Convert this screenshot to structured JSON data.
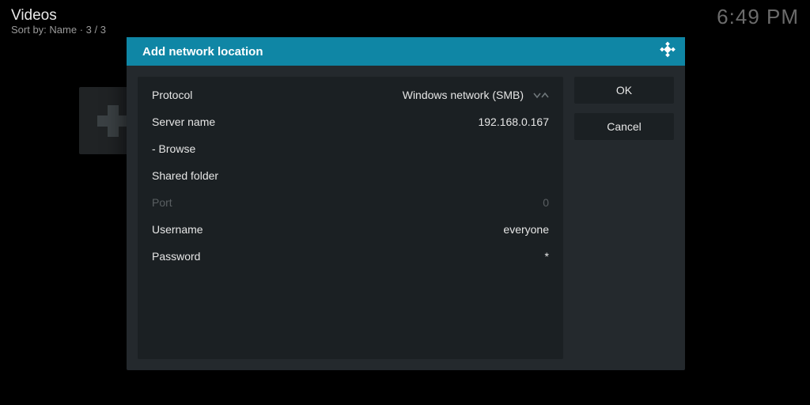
{
  "background": {
    "title": "Videos",
    "sort_prefix": "Sort by: ",
    "sort_field": "Name",
    "counter_sep": "  ·  ",
    "counter": "3 / 3",
    "clock": "6:49 PM"
  },
  "dialog": {
    "title": "Add network location",
    "buttons": {
      "ok": "OK",
      "cancel": "Cancel"
    },
    "rows": {
      "protocol": {
        "label": "Protocol",
        "value": "Windows network (SMB)"
      },
      "server": {
        "label": "Server name",
        "value": "192.168.0.167"
      },
      "browse": {
        "label": "- Browse"
      },
      "shared": {
        "label": "Shared folder",
        "value": ""
      },
      "port": {
        "label": "Port",
        "value": "0"
      },
      "username": {
        "label": "Username",
        "value": "everyone"
      },
      "password": {
        "label": "Password",
        "value": "*"
      }
    }
  }
}
